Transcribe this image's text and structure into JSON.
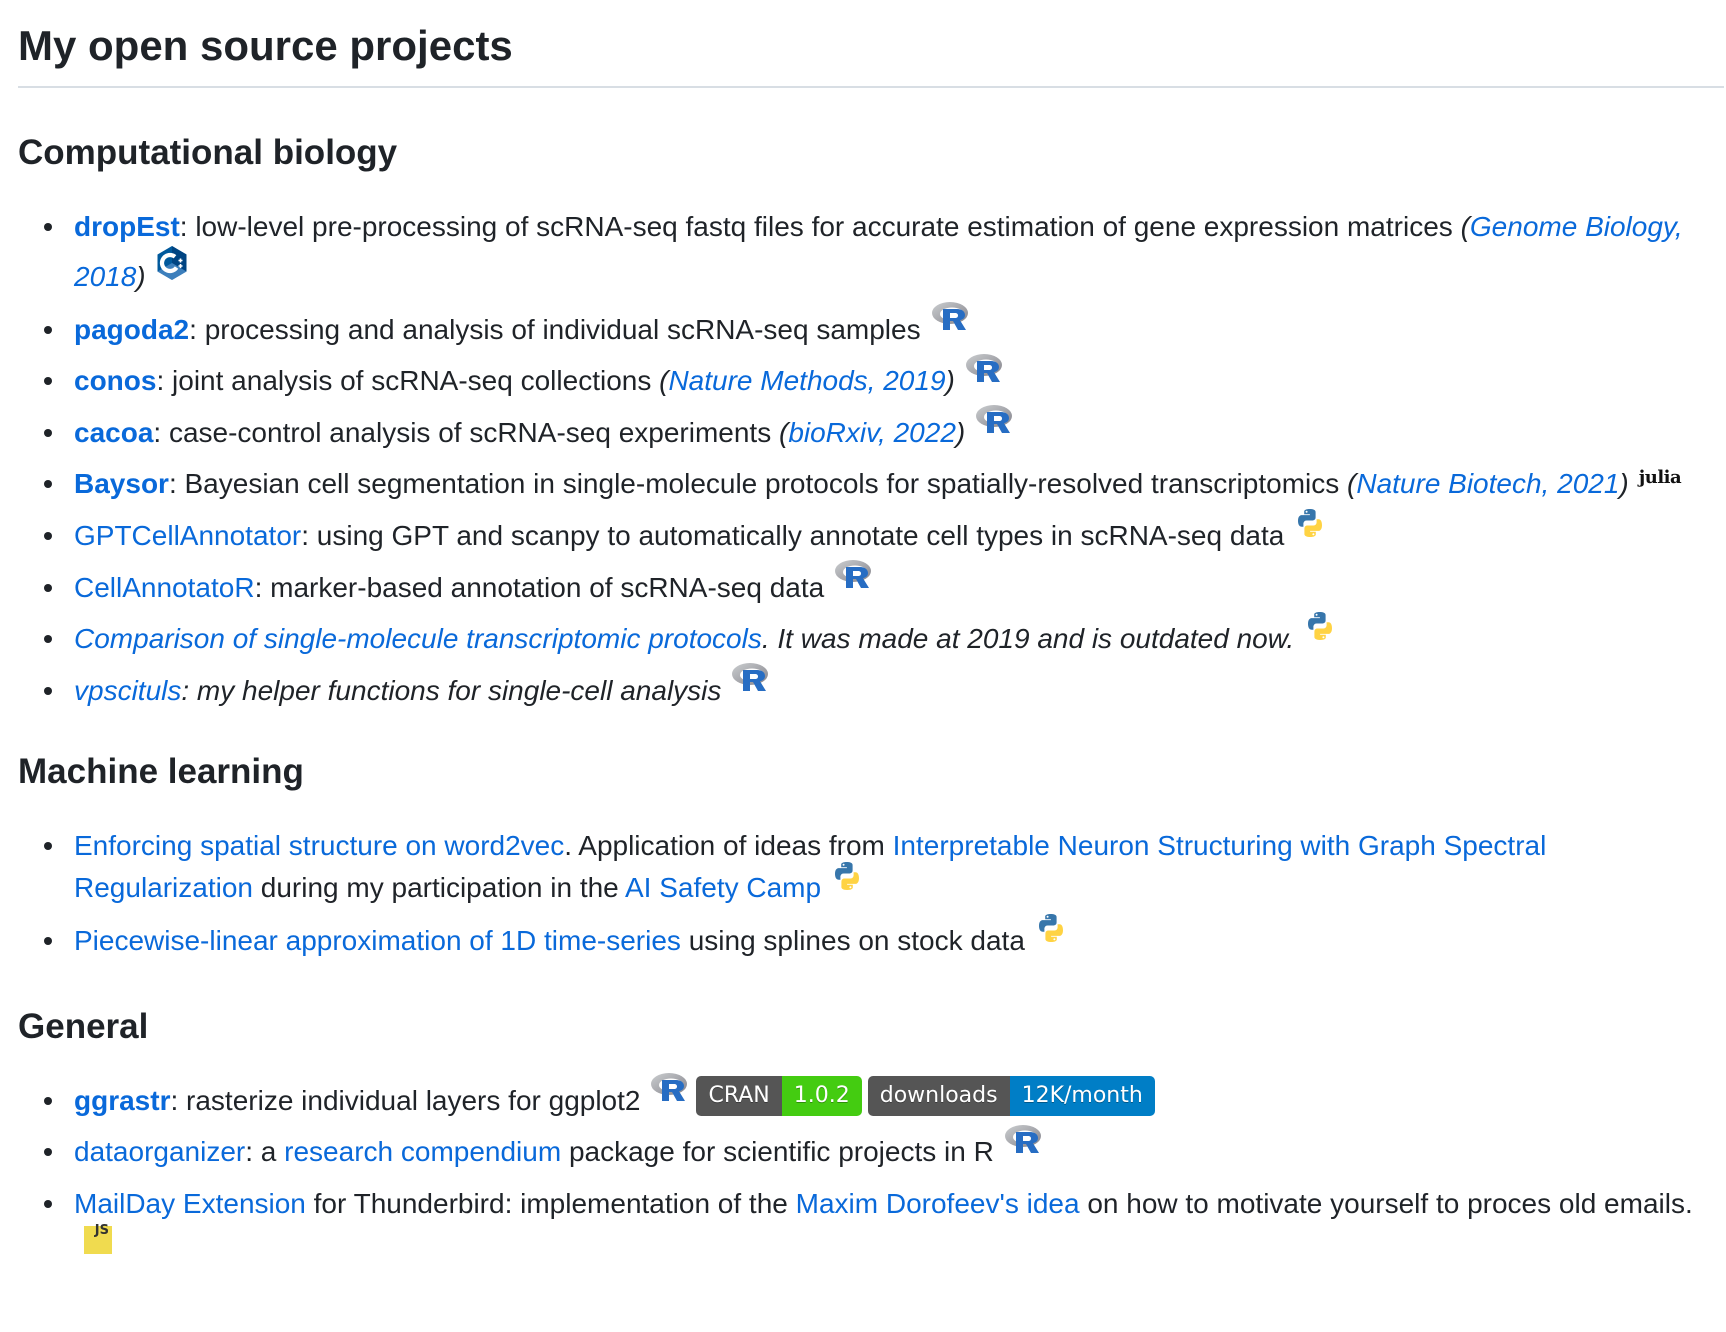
{
  "title": "My open source projects",
  "sections": {
    "bio": {
      "heading": "Computational biology",
      "items": [
        {
          "link": "dropEst",
          "text": ": low-level pre-processing of scRNA-seq fastq files for accurate estimation of gene expression matrices ",
          "pub_open": "(",
          "pub": "Genome Biology, 2018",
          "pub_close": ")",
          "icon": "cpp-icon"
        },
        {
          "link": "pagoda2",
          "text": ": processing and analysis of individual scRNA-seq samples",
          "icon": "r-icon"
        },
        {
          "link": "conos",
          "text": ": joint analysis of scRNA-seq collections ",
          "pub_open": "(",
          "pub": "Nature Methods, 2019",
          "pub_close": ")",
          "icon": "r-icon"
        },
        {
          "link": "cacoa",
          "text": ": case-control analysis of scRNA-seq experiments ",
          "pub_open": "(",
          "pub": "bioRxiv, 2022",
          "pub_close": ")",
          "icon": "r-icon"
        },
        {
          "link": "Baysor",
          "text": ": Bayesian cell segmentation in single-molecule protocols for spatially-resolved transcriptomics ",
          "pub_open": "(",
          "pub": "Nature Biotech, 2021",
          "pub_close": ")",
          "icon": "julia-icon",
          "icon_text": "julia"
        },
        {
          "link": "GPTCellAnnotator",
          "text": ": using GPT and scanpy to automatically annotate cell types in scRNA-seq data",
          "icon": "python-icon"
        },
        {
          "link": "CellAnnotatoR",
          "text": ": marker-based annotation of scRNA-seq data",
          "icon": "r-icon"
        },
        {
          "link": "Comparison of single-molecule transcriptomic protocols",
          "text": ". It was made at 2019 and is outdated now.",
          "icon": "python-icon"
        },
        {
          "link": "vpscituls",
          "text": ": my helper functions for single-cell analysis",
          "icon": "r-icon"
        }
      ]
    },
    "ml": {
      "heading": "Machine learning",
      "items": [
        {
          "link1": "Enforcing spatial structure on word2vec",
          "text1": ". Application of ideas from ",
          "link2": "Interpretable Neuron Structuring with Graph Spectral Regularization",
          "text2": " during my participation in the ",
          "link3": "AI Safety Camp",
          "icon": "python-icon"
        },
        {
          "link1": "Piecewise-linear approximation of 1D time-series",
          "text1": " using splines on stock data",
          "icon": "python-icon"
        }
      ]
    },
    "general": {
      "heading": "General",
      "items": [
        {
          "link1": "ggrastr",
          "text1": ": rasterize individual layers for ggplot2",
          "icon": "r-icon",
          "badges": [
            {
              "label": "CRAN",
              "value": "1.0.2",
              "color": "#4c1"
            },
            {
              "label": "downloads",
              "value": "12K/month",
              "color": "#007ec6"
            }
          ]
        },
        {
          "link1": "dataorganizer",
          "text1": ": a ",
          "link2": "research compendium",
          "text2": " package for scientific projects in R",
          "icon": "r-icon"
        },
        {
          "link1": "MailDay Extension",
          "text1": " for Thunderbird: implementation of the ",
          "link2": "Maxim Dorofeev's idea",
          "text2": " on how to motivate yourself to proces old emails.",
          "icon": "js-icon",
          "icon_text": "JS"
        }
      ]
    }
  },
  "colors": {
    "text": "#1f2328",
    "link": "#0969da",
    "rule": "#d8dee4"
  }
}
